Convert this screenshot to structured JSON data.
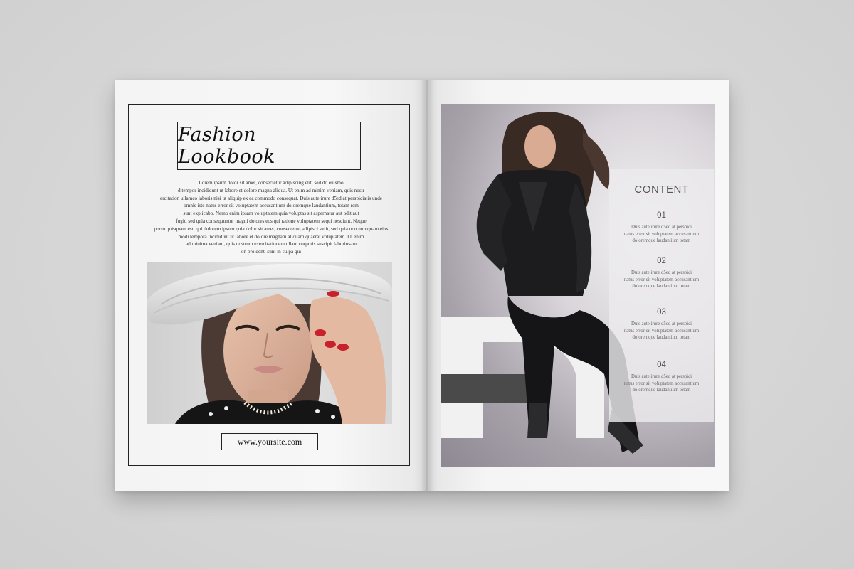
{
  "left_page": {
    "title": "Fashion Lookbook",
    "body_lines": [
      "Lorem ipsum dolor sit amet, consectetur adipiscing elit, sed do eiusmo",
      "d tempor incididunt ut labore et dolore magna aliqua. Ut enim ad minim veniam, quis nostr",
      "ercitation ullamco laboris nisi ut aliquip ex ea commodo consequat. Duis aute irure d5ed at perspiciatis unde",
      "omnis iste natus error sit voluptatem accusantium doloremque laudantium, totam rem",
      "sunt explicabo. Nemo enim ipsam voluptatem quia voluptas sit aspernatur aut odit aut",
      "fugit, sed quia consequuntur magni dolores eos qui ratione voluptatem sequi nesciunt. Neque",
      "porro quisquam est, qui dolorem ipsum quia dolor sit amet, consectetur, adipisci velit, sed quia non numquam eius",
      "modi tempora incididunt ut labore et dolore magnam aliquam quaerat voluptatem. Ut enim",
      "ad minima veniam, quis nostrum exercitationem ullam corporis suscipit laboriosam",
      "on proident, sunt in culpa qui"
    ],
    "website": "www.yoursite.com"
  },
  "right_page": {
    "content_heading": "CONTENT",
    "items": [
      {
        "number": "01",
        "lines": [
          "Duis aute irure d5ed at perspici",
          "natus error sit voluptatem accusantium",
          "doloremque laudantium totam"
        ]
      },
      {
        "number": "02",
        "lines": [
          "Duis aute irure d5ed at perspici",
          "natus error sit voluptatem accusantium",
          "doloremque laudantium totam"
        ]
      },
      {
        "number": "03",
        "lines": [
          "Duis aute irure d5ed at perspici",
          "natus error sit voluptatem accusantium",
          "doloremque laudantium totam"
        ]
      },
      {
        "number": "04",
        "lines": [
          "Duis aute irure d5ed at perspici",
          "natus error sit voluptatem accusantium",
          "doloremque laudantium totam"
        ]
      }
    ]
  },
  "colors": {
    "background": "#d9d9d9",
    "paper": "#f7f7f7",
    "ink": "#222222",
    "nail_polish": "#c8202c",
    "panel_text": "#555555"
  }
}
